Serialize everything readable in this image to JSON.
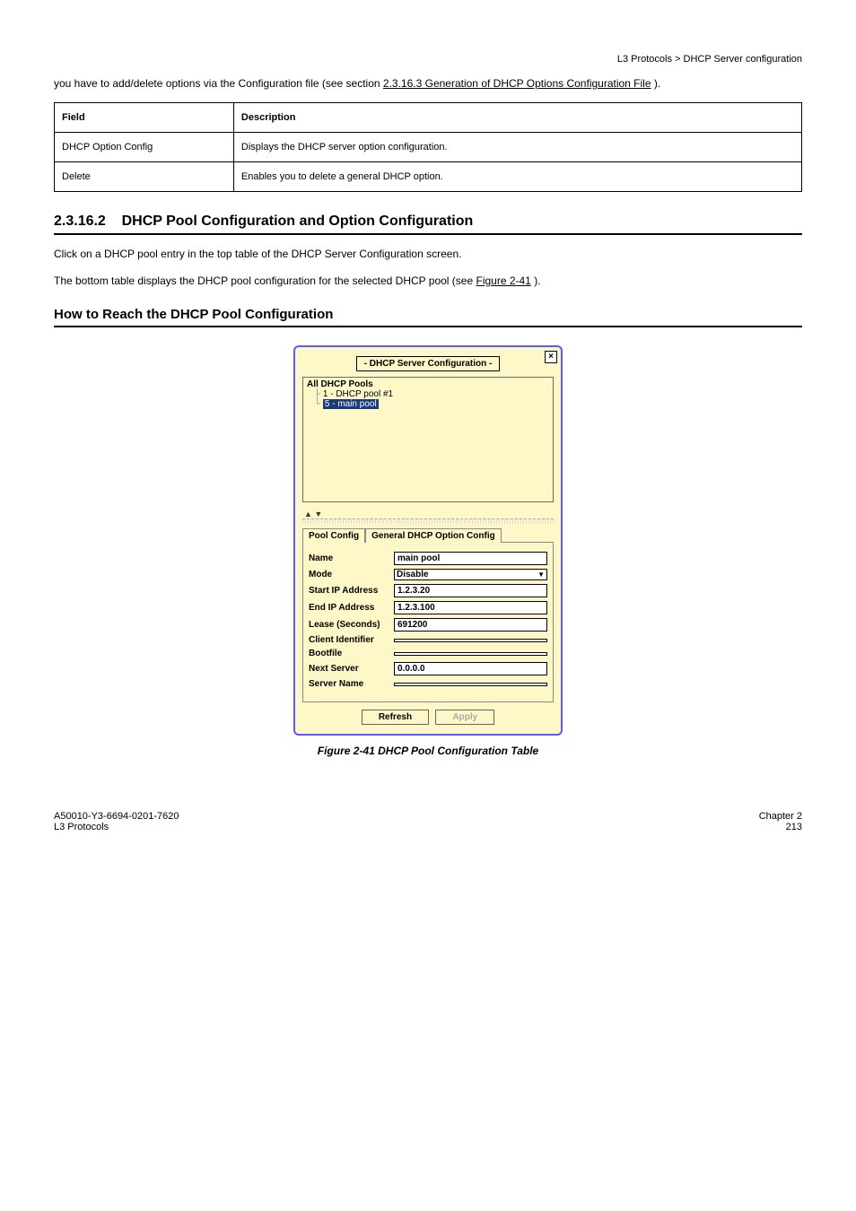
{
  "header": {
    "breadcrumb": "L3 Protocols > DHCP Server configuration"
  },
  "upper_text": {
    "pre": "you have to add/delete options via the Configuration file (see section ",
    "link": "2.3.16.3 Generation of DHCP Options Configuration File",
    "post": ")."
  },
  "field_table": {
    "col1_header": "Field",
    "col2_header": "Description",
    "rows": [
      {
        "field": "DHCP Option Config",
        "desc": "Displays the DHCP server option configuration."
      },
      {
        "field": "Delete",
        "desc": "Enables you to delete a general DHCP option."
      }
    ]
  },
  "section": {
    "number": "2.3.16.2",
    "title": "DHCP Pool Configuration and Option Configuration",
    "p1": "Click on a DHCP pool entry in the top table of the DHCP Server Configuration screen.",
    "p2_pre": "The bottom table displays the DHCP pool configuration for the selected DHCP pool (see ",
    "p2_link": "Figure 2-41",
    "p2_post": ")."
  },
  "how_to_title": "How to Reach the DHCP Pool Configuration",
  "dialog": {
    "title": "- DHCP Server Configuration -",
    "close_label": "×",
    "tree_root": "All DHCP Pools",
    "tree_item1": "1 - DHCP pool #1",
    "tree_item2": "5 - main pool",
    "tabs": {
      "active": "Pool Config",
      "inactive": "General DHCP Option Config"
    },
    "fields": {
      "name_lbl": "Name",
      "name_val": "main pool",
      "mode_lbl": "Mode",
      "mode_val": "Disable",
      "start_lbl": "Start IP Address",
      "start_val": "1.2.3.20",
      "end_lbl": "End IP Address",
      "end_val": "1.2.3.100",
      "lease_lbl": "Lease (Seconds)",
      "lease_val": "691200",
      "client_lbl": "Client Identifier",
      "client_val": "",
      "boot_lbl": "Bootfile",
      "boot_val": "",
      "next_lbl": "Next Server",
      "next_val": "0.0.0.0",
      "server_lbl": "Server Name",
      "server_val": ""
    },
    "buttons": {
      "refresh": "Refresh",
      "apply": "Apply"
    }
  },
  "figure_caption": "Figure 2-41 DHCP Pool Configuration Table",
  "footer": {
    "doc_id": "A50010-Y3-6694-0201-7620",
    "chapter": "Chapter 2",
    "section": "L3 Protocols",
    "page": "213"
  }
}
